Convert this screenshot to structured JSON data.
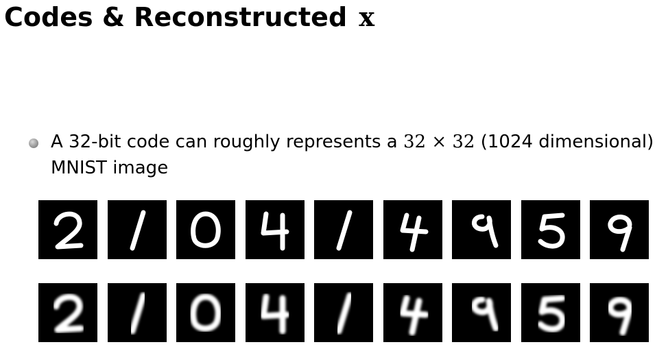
{
  "slide": {
    "title": "Codes & Reconstructed",
    "title_symbol": "x"
  },
  "bullet": {
    "line1_before": "A 32-bit code can roughly represents a ",
    "line1_math": "32 × 32",
    "line1_after": " (1024 dimensional)",
    "line2": "MNIST image"
  },
  "original_digits": [
    {
      "label": "2",
      "icon": "digit-2-original"
    },
    {
      "label": "1",
      "icon": "digit-1-original"
    },
    {
      "label": "0",
      "icon": "digit-0-original"
    },
    {
      "label": "4",
      "icon": "digit-4-original"
    },
    {
      "label": "1",
      "icon": "digit-1-original"
    },
    {
      "label": "4",
      "icon": "digit-4-original"
    },
    {
      "label": "9",
      "icon": "digit-9-original"
    },
    {
      "label": "5",
      "icon": "digit-5-original"
    },
    {
      "label": "9",
      "icon": "digit-9-original"
    }
  ],
  "reconstructed_digits": [
    {
      "label": "2",
      "icon": "digit-2-reconstructed"
    },
    {
      "label": "1",
      "icon": "digit-1-reconstructed"
    },
    {
      "label": "0",
      "icon": "digit-0-reconstructed"
    },
    {
      "label": "4",
      "icon": "digit-4-reconstructed"
    },
    {
      "label": "1",
      "icon": "digit-1-reconstructed"
    },
    {
      "label": "4",
      "icon": "digit-4-reconstructed"
    },
    {
      "label": "9",
      "icon": "digit-9-reconstructed"
    },
    {
      "label": "5",
      "icon": "digit-5-reconstructed"
    },
    {
      "label": "9",
      "icon": "digit-9-reconstructed"
    }
  ],
  "colors": {
    "tile_background": "#000000",
    "stroke": "#ffffff",
    "text": "#000000",
    "bullet": "#8a8a8a"
  }
}
